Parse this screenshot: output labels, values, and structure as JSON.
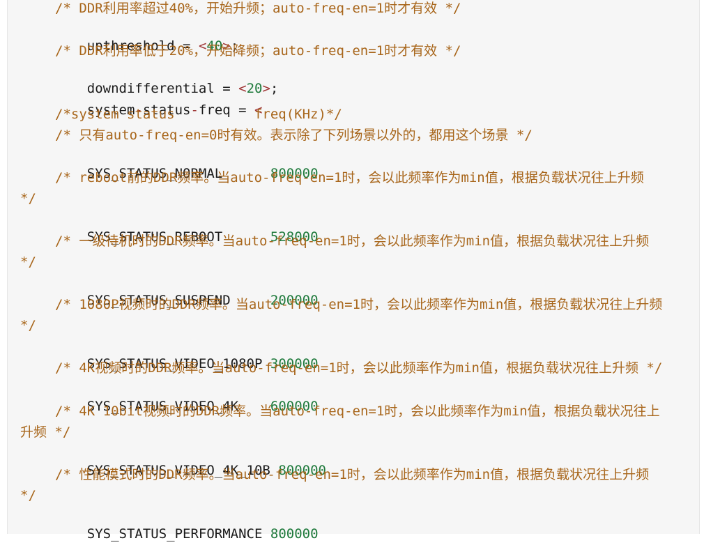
{
  "lines": {
    "l1": "/* DDR利用率超过40%，开始升频；auto-freq-en=1时才有效 */",
    "l2": {
      "key": "upthreshold",
      "eq": " = ",
      "lt": "<",
      "num": "40",
      "gt": ">",
      "semi": ";"
    },
    "l3": "/* DDR利用率低于20%，开始降频；auto-freq-en=1时才有效 */",
    "l4": {
      "key": "downdifferential",
      "eq": " = ",
      "lt": "<",
      "num": "20",
      "gt": ">",
      "semi": ";"
    },
    "l5": {
      "key1": "system",
      "dash": "-",
      "key2": "status",
      "dash2": "-",
      "key3": "freq",
      "eq": " = ",
      "lt": "<"
    },
    "l6": "/*system status          freq(KHz)*/",
    "l7": "/* 只有auto-freq-en=0时有效。表示除了下列场景以外的，都用这个场景 */",
    "l8": {
      "name": "SYS_STATUS_NORMAL      ",
      "value": "800000"
    },
    "l9": "/* reboot前的DDR频率。当auto-freq-en=1时，会以此频率作为min值，根据负载状况往上升频",
    "l10": "*/",
    "l11": {
      "name": "SYS_STATUS_REBOOT      ",
      "value": "528000"
    },
    "l12": "/* 一级待机时的DDR频率。当auto-freq-en=1时，会以此频率作为min值，根据负载状况往上升频",
    "l13": "*/",
    "l14": {
      "name": "SYS_STATUS_SUSPEND     ",
      "value": "200000"
    },
    "l15": "/* 1080P视频时的DDR频率。当auto-freq-en=1时，会以此频率作为min值，根据负载状况往上升频",
    "l16": "*/",
    "l17": {
      "name": "SYS_STATUS_VIDEO_1080P ",
      "value": "300000"
    },
    "l18": "/* 4K视频时的DDR频率。当auto-freq-en=1时，会以此频率作为min值，根据负载状况往上升频 */",
    "l19": {
      "name": "SYS_STATUS_VIDEO_4K    ",
      "value": "600000"
    },
    "l20": "/* 4K 10bit视频时的DDR频率。当auto-freq-en=1时，会以此频率作为min值，根据负载状况往上",
    "l21": "升频 */",
    "l22": {
      "name": "SYS_STATUS_VIDEO_4K_10B ",
      "value": "800000"
    },
    "l23": "/* 性能模式时的DDR频率。当auto-freq-en=1时，会以此频率作为min值，根据负载状况往上升频",
    "l24": "*/",
    "l25": {
      "name": "SYS_STATUS_PERFORMANCE ",
      "value": "800000"
    }
  }
}
